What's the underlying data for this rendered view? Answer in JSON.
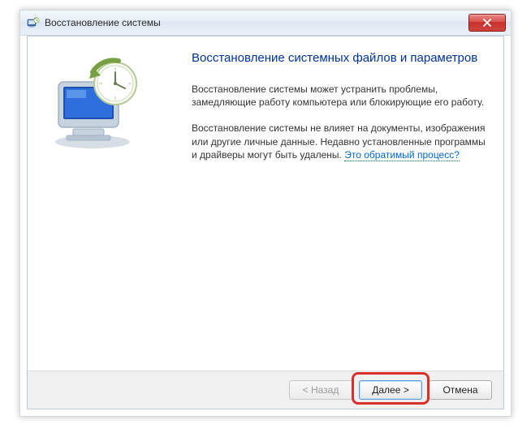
{
  "window": {
    "title": "Восстановление системы"
  },
  "content": {
    "heading": "Восстановление системных файлов и параметров",
    "para1": "Восстановление системы может устранить проблемы, замедляющие работу компьютера или блокирующие его работу.",
    "para2_pre": "Восстановление системы не влияет на документы, изображения или другие личные данные. Недавно установленные программы и драйверы могут быть удалены. ",
    "para2_link": "Это обратимый процесс?"
  },
  "buttons": {
    "back": "< Назад",
    "next": "Далее >",
    "cancel": "Отмена"
  }
}
